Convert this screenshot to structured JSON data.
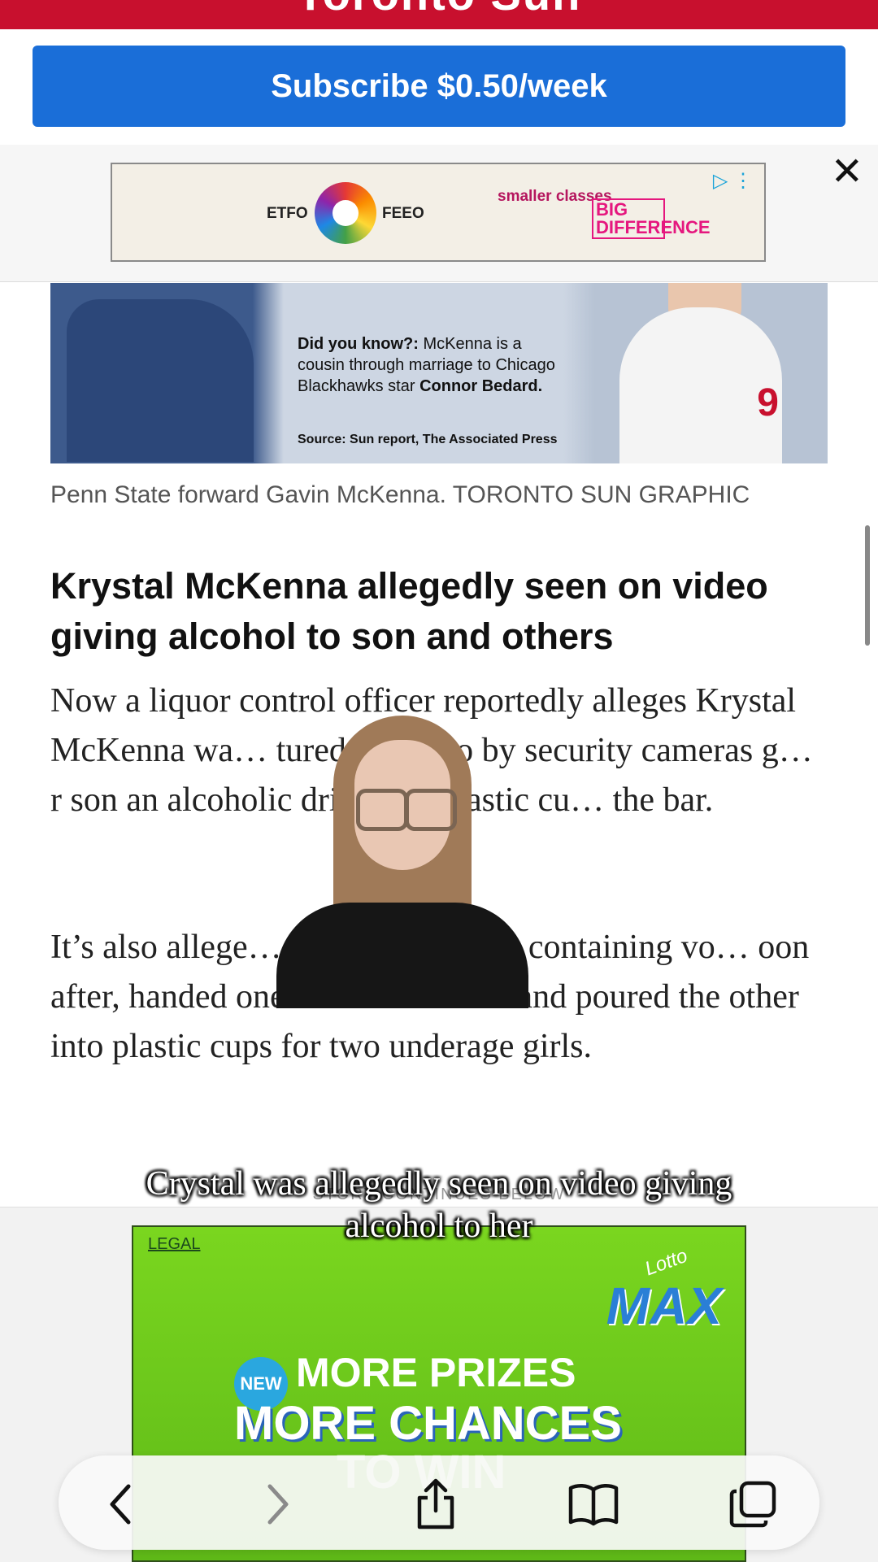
{
  "header": {
    "brand": "Toronto Sun",
    "subscribe_label": "Subscribe $0.50/week"
  },
  "top_ad": {
    "etfo": "ETFO",
    "feeo": "FEEO",
    "tagline": "smaller classes",
    "tagline_emphasis": "BIG DIFFERENCE"
  },
  "graphic": {
    "did_you_know_label": "Did you know?:",
    "did_you_know_text": "McKenna is a cousin through marriage to Chicago Blackhawks star",
    "did_you_know_name": "Connor Bedard.",
    "source": "Source: Sun report, The Associated Press",
    "caption": "Penn State forward Gavin McKenna. TORONTO SUN GRAPHIC"
  },
  "article": {
    "headline": "Krystal McKenna allegedly seen on video giving alcohol to son and others",
    "paragraph1": "Now a liquor control officer reportedly alleges Krystal McKenna wa… tured on video by security cameras g… r son an alcoholic drink in a plastic cu… the bar.",
    "paragraph2": "It’s also allege… wo mixed drinks containing vo… oon after, handed one drink to her son and poured the other into plastic cups for two underage girls."
  },
  "video_overlay": {
    "subtitle": "Crystal was allegedly seen on video giving alcohol to her"
  },
  "story_note": "STORY CONTINUES BELOW",
  "bottom_ad": {
    "legal": "LEGAL",
    "lotto": "Lotto",
    "max": "MAX",
    "new_badge": "NEW",
    "line1": "MORE PRIZES",
    "line2": "MORE CHANCES",
    "line3": "TO WIN"
  },
  "browser_toolbar": {
    "icons": [
      "back-icon",
      "forward-icon",
      "share-icon",
      "bookmarks-icon",
      "tabs-icon"
    ]
  }
}
